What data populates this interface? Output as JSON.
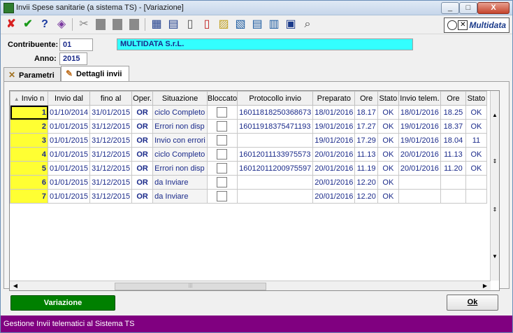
{
  "window": {
    "title": "Invii Spese sanitarie (a sistema TS) - [Variazione]",
    "min": "_",
    "max": "□",
    "close": "X"
  },
  "toolbar": {
    "icons": [
      "✘",
      "✔",
      "?",
      "◈",
      "✂",
      "▮",
      "▮",
      "▮",
      "▦",
      "▤",
      "▯",
      "▯",
      "▨",
      "▧",
      "▤",
      "▥",
      "▣",
      "⌕"
    ],
    "logo": "Multidata"
  },
  "header": {
    "contribuente_label": "Contribuente:",
    "contribuente_value": "01",
    "company": "MULTIDATA S.r.L.",
    "anno_label": "Anno:",
    "anno_value": "2015"
  },
  "tabs": [
    {
      "label": "Parametri",
      "icon": "✕"
    },
    {
      "label": "Dettagli invii",
      "icon": "✎"
    }
  ],
  "table": {
    "columns": [
      "Invio n",
      "Invio dal",
      "fino al",
      "Oper.",
      "Situazione",
      "Bloccato",
      "Protocollo invio",
      "Preparato",
      "Ore",
      "Stato",
      "Invio telem.",
      "Ore",
      "Stato"
    ],
    "sort_indicator": "▲",
    "rows": [
      [
        "1",
        "01/10/2014",
        "31/01/2015",
        "OR",
        "ciclo Completo",
        "",
        "16011818250368673",
        "18/01/2016",
        "18.17",
        "OK",
        "18/01/2016",
        "18.25",
        "OK"
      ],
      [
        "2",
        "01/01/2015",
        "31/12/2015",
        "OR",
        "Errori non disp",
        "",
        "16011918375471193",
        "19/01/2016",
        "17.27",
        "OK",
        "19/01/2016",
        "18.37",
        "OK"
      ],
      [
        "3",
        "01/01/2015",
        "31/12/2015",
        "OR",
        "Invio con errori",
        "",
        "",
        "19/01/2016",
        "17.29",
        "OK",
        "19/01/2016",
        "18.04",
        "11"
      ],
      [
        "4",
        "01/01/2015",
        "31/12/2015",
        "OR",
        "ciclo Completo",
        "",
        "16012011133975573",
        "20/01/2016",
        "11.13",
        "OK",
        "20/01/2016",
        "11.13",
        "OK"
      ],
      [
        "5",
        "01/01/2015",
        "31/12/2015",
        "OR",
        "Errori non disp",
        "",
        "16012011200975597",
        "20/01/2016",
        "11.19",
        "OK",
        "20/01/2016",
        "11.20",
        "OK"
      ],
      [
        "6",
        "01/01/2015",
        "31/12/2015",
        "OR",
        "da Inviare",
        "",
        "",
        "20/01/2016",
        "12.20",
        "OK",
        "",
        "",
        " "
      ],
      [
        "7",
        "01/01/2015",
        "31/12/2015",
        "OR",
        "da Inviare",
        "",
        "",
        "20/01/2016",
        "12.20",
        "OK",
        "",
        "",
        ""
      ]
    ]
  },
  "buttons": {
    "variazione": "Variazione",
    "ok": "Ok"
  },
  "colors": {
    "status_bar": "#800080",
    "variazione": "#008000",
    "company_bar": "#33ffff",
    "invio_col": "#ffff33"
  },
  "status": "Gestione Invii telematici al Sistema TS"
}
